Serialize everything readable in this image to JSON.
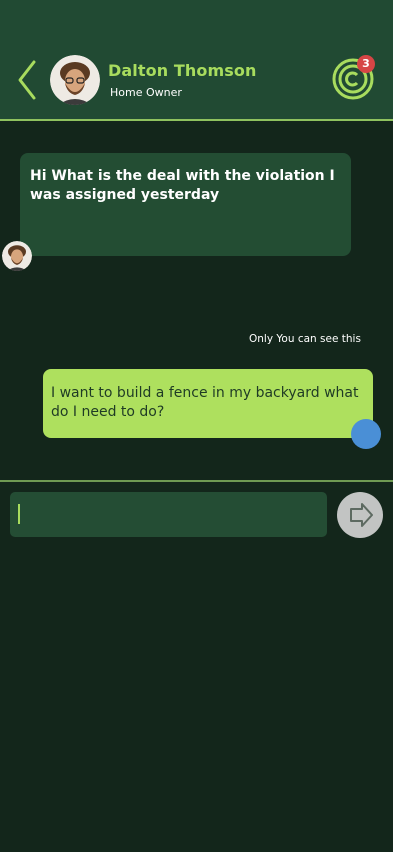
{
  "header": {
    "contact_name": "Dalton Thomson",
    "contact_role": "Home Owner",
    "notification_count": "3",
    "back_icon": "chevron-left-icon",
    "logo_icon": "community-logo-icon"
  },
  "messages": [
    {
      "direction": "incoming",
      "text": "Hi What is the deal with the violation I was assigned yesterday"
    },
    {
      "direction": "outgoing",
      "note": "Only You can see this",
      "text": "I want to build a fence in my backyard what do I need to do?"
    }
  ],
  "composer": {
    "value": "",
    "send_icon": "send-arrow-icon"
  },
  "colors": {
    "header_bg": "#214a33",
    "page_bg": "#13261b",
    "accent_green": "#a8dc5e",
    "outgoing_bubble": "#aee05e",
    "incoming_bubble": "#234d33",
    "badge_red": "#d64545",
    "status_blue": "#4a8fd6"
  }
}
